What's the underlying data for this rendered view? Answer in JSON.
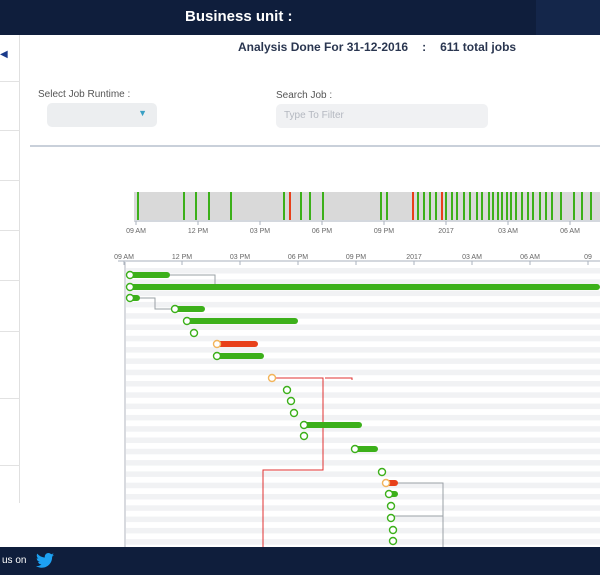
{
  "header": {
    "title": "Business unit :"
  },
  "summary": {
    "analysis_label": "Analysis Done For 31-12-2016",
    "separator": ":",
    "total_jobs": "611 total jobs"
  },
  "filters": {
    "runtime_label": "Select Job Runtime :",
    "search_label": "Search Job :",
    "search_placeholder": "Type To Filter"
  },
  "overview_axis": [
    "09 AM",
    "12 PM",
    "03 PM",
    "06 PM",
    "09 PM",
    "2017",
    "03 AM",
    "06 AM"
  ],
  "gantt_axis": [
    "09 AM",
    "12 PM",
    "03 PM",
    "06 PM",
    "09 PM",
    "2017",
    "03 AM",
    "06 AM",
    "09"
  ],
  "colors": {
    "success": "#3cb01a",
    "failed": "#e8401a",
    "warning": "#f2b45a",
    "navy": "#0f1e3c",
    "link": "#e03030"
  },
  "footer": {
    "follow_text": "us on",
    "icon": "twitter-icon"
  }
}
